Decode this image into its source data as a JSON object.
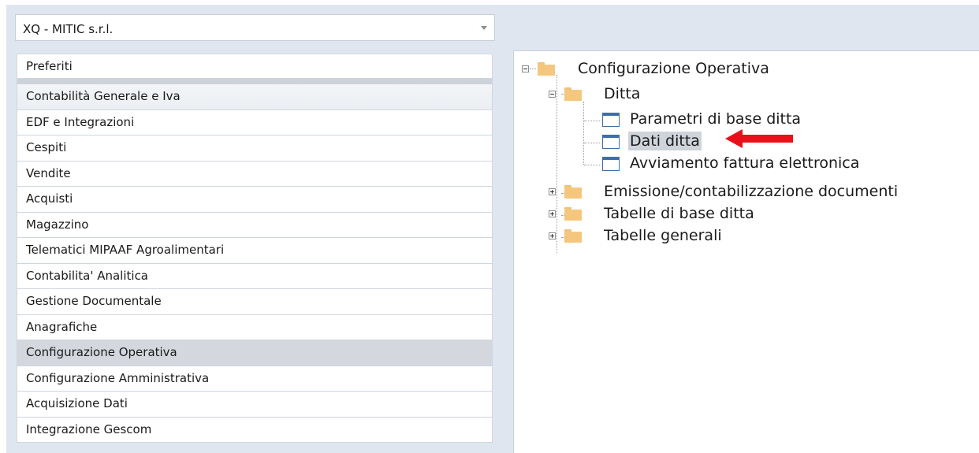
{
  "company_selector": {
    "value": "XQ - MITIC s.r.l."
  },
  "menu": {
    "favorites": "Preferiti",
    "items": [
      "Contabilità Generale e Iva",
      "EDF e Integrazioni",
      "Cespiti",
      "Vendite",
      "Acquisti",
      "Magazzino",
      "Telematici MIPAAF Agroalimentari",
      "Contabilita' Analitica",
      "Gestione Documentale",
      "Anagrafiche",
      "Configurazione Operativa",
      "Configurazione Amministrativa",
      "Acquisizione Dati",
      "Integrazione Gescom"
    ],
    "active_item": "Configurazione Operativa"
  },
  "tree": {
    "root": "Configurazione Operativa",
    "ditta": "Ditta",
    "parametri": "Parametri di base ditta",
    "dati": "Dati ditta",
    "avviamento": "Avviamento fattura elettronica",
    "emissione": "Emissione/contabilizzazione documenti",
    "tabelle_base": "Tabelle di base ditta",
    "tabelle_generali": "Tabelle generali",
    "selected": "Dati ditta"
  },
  "colors": {
    "highlight_arrow": "#e8101a",
    "folder": "#f5c77e",
    "doc_border": "#3f6ea8",
    "selection": "#cfd4db"
  },
  "icons": [
    "chevron-down-icon",
    "folder-icon",
    "document-icon",
    "expand-icon",
    "collapse-icon",
    "arrow-icon"
  ]
}
